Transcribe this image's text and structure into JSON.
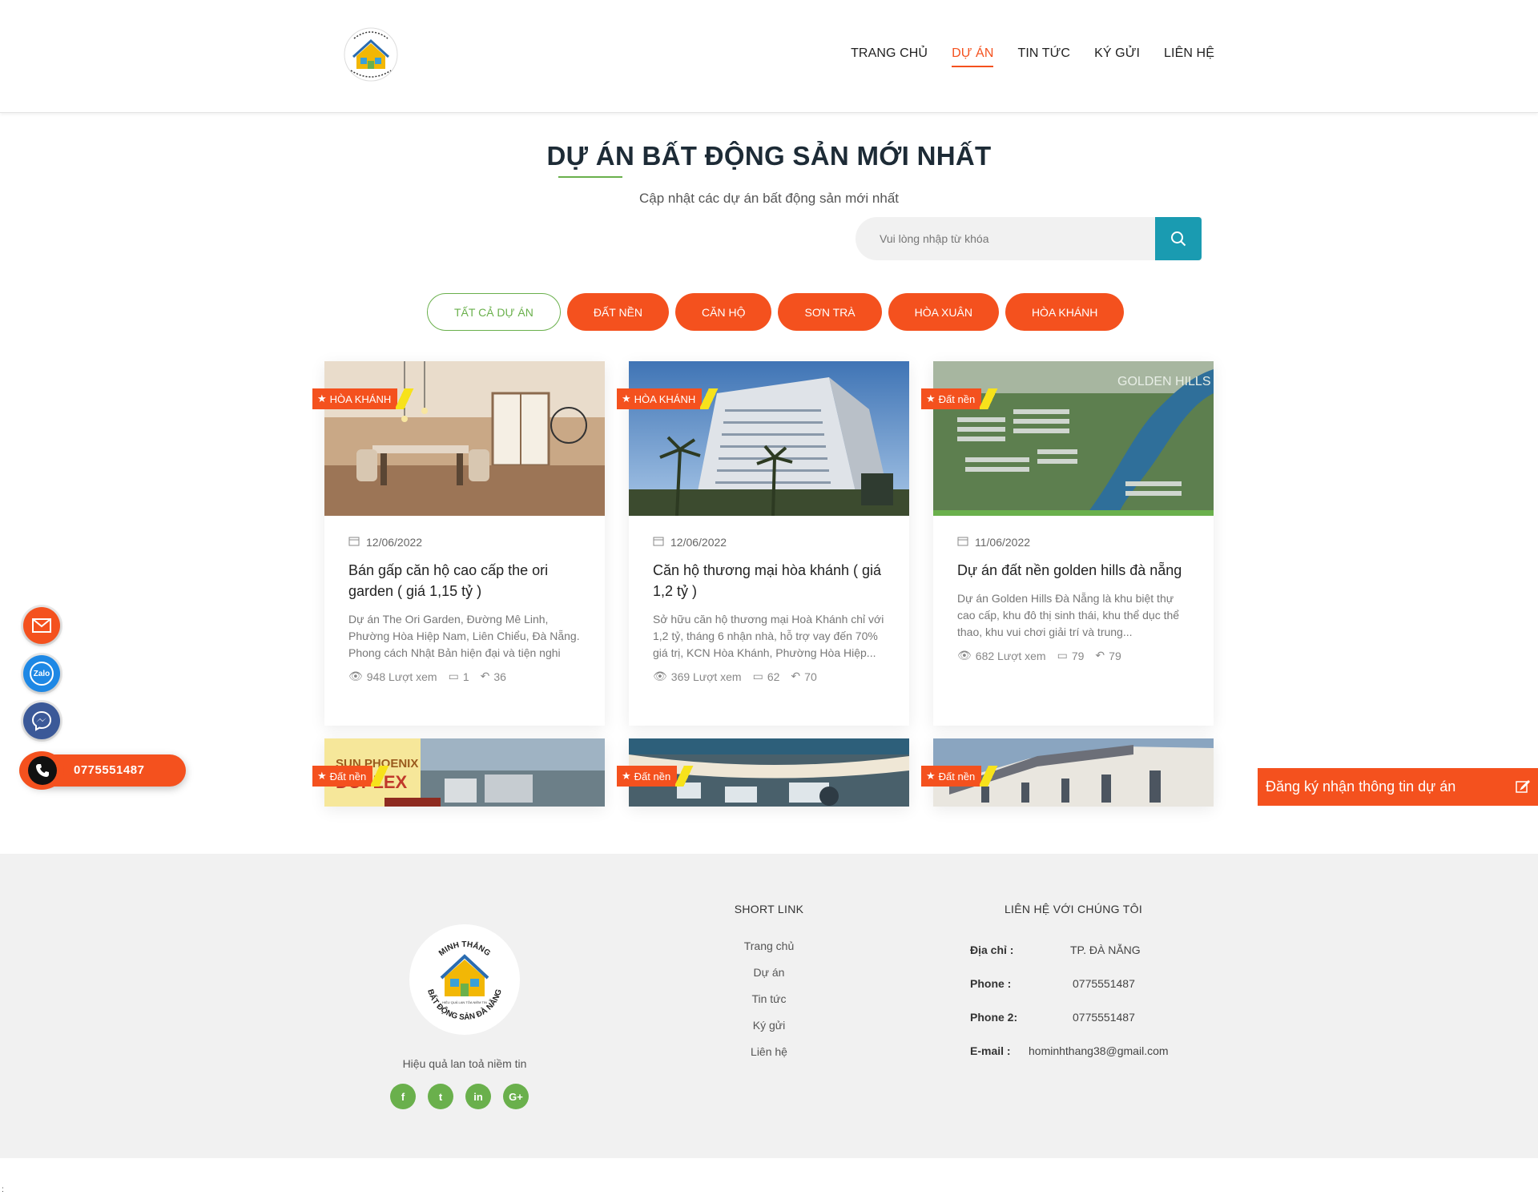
{
  "brand": {
    "logo_text_top": "MINH THẮNG",
    "logo_text_bottom": "BẤT ĐỘNG SẢN ĐÀ NẴNG",
    "logo_tagline": "HIỆU QUẢ LAN TỎA NIỀM TIN"
  },
  "nav": {
    "items": [
      {
        "label": "TRANG CHỦ"
      },
      {
        "label": "DỰ ÁN"
      },
      {
        "label": "TIN TỨC"
      },
      {
        "label": "KÝ GỬI"
      },
      {
        "label": "LIÊN HỆ"
      }
    ],
    "active_index": 1
  },
  "hero": {
    "title": "DỰ ÁN BẤT ĐỘNG SẢN MỚI NHẤT",
    "subtitle": "Cập nhật các dự án bất động sản mới nhất"
  },
  "search": {
    "placeholder": "Vui lòng nhập từ khóa",
    "icon": "search-icon"
  },
  "filters": [
    "TẤT CẢ DỰ ÁN",
    "ĐẤT NỀN",
    "CĂN HỘ",
    "SƠN TRÀ",
    "HÒA XUÂN",
    "HÒA KHÁNH"
  ],
  "cards": [
    {
      "badge": "HÒA KHÁNH",
      "date": "12/06/2022",
      "title": "Bán gấp căn hộ cao cấp the ori garden ( giá 1,15 tỷ )",
      "desc": "Dự án The Ori Garden, Đường Mê Linh, Phường Hòa Hiệp Nam, Liên Chiểu, Đà Nẵng. Phong cách Nhật Bản hiện đại và tiện nghi",
      "views": "948 Lượt xem",
      "comments": "1",
      "shares": "36"
    },
    {
      "badge": "HÒA KHÁNH",
      "date": "12/06/2022",
      "title": "Căn hộ thương mại hòa khánh ( giá 1,2 tỷ )",
      "desc": "Sở hữu căn hộ thương mại Hoà Khánh chỉ với 1,2 tỷ, tháng 6 nhận nhà, hỗ trợ vay đến 70% giá trị, KCN Hòa Khánh, Phường Hòa Hiệp...",
      "views": "369 Lượt xem",
      "comments": "62",
      "shares": "70"
    },
    {
      "badge": "Đất nền",
      "date": "11/06/2022",
      "title": "Dự án đất nền golden hills đà nẵng",
      "desc": "Dự án Golden Hills Đà Nẵng là khu biệt thự cao cấp, khu đô thị sinh thái, khu thể dục thể thao, khu vui chơi giải trí và trung...",
      "views": "682 Lượt xem",
      "comments": "79",
      "shares": "79",
      "image_text": "GOLDEN HILLS"
    }
  ],
  "cards_row2": [
    {
      "badge": "Đất nền",
      "image_text": "SUN PHOENIX DUPLEX"
    },
    {
      "badge": "Đất nền"
    },
    {
      "badge": "Đất nền"
    }
  ],
  "floating": {
    "phone": "0775551487",
    "zalo_label": "Zalo",
    "register": "Đăng ký nhận thông tin dự án"
  },
  "footer": {
    "slogan": "Hiệu quả lan toả niềm tin",
    "social": [
      "f",
      "t",
      "in",
      "G+"
    ],
    "short_link_heading": "SHORT LINK",
    "short_links": [
      "Trang chủ",
      "Dự án",
      "Tin tức",
      "Ký gửi",
      "Liên hệ"
    ],
    "contact_heading": "LIÊN HỆ VỚI CHÚNG TÔI",
    "contact": [
      {
        "label": "Địa chỉ :",
        "value": "TP. ĐÀ NẴNG"
      },
      {
        "label": "Phone :",
        "value": "0775551487"
      },
      {
        "label": "Phone 2:",
        "value": "0775551487"
      },
      {
        "label": "E-mail :",
        "value": "hominhthang38@gmail.com"
      }
    ]
  },
  "colors": {
    "accent": "#f4511e",
    "green": "#6ab04c",
    "search_button": "#1a9bb1",
    "badge_stripe": "#f7e21b"
  }
}
